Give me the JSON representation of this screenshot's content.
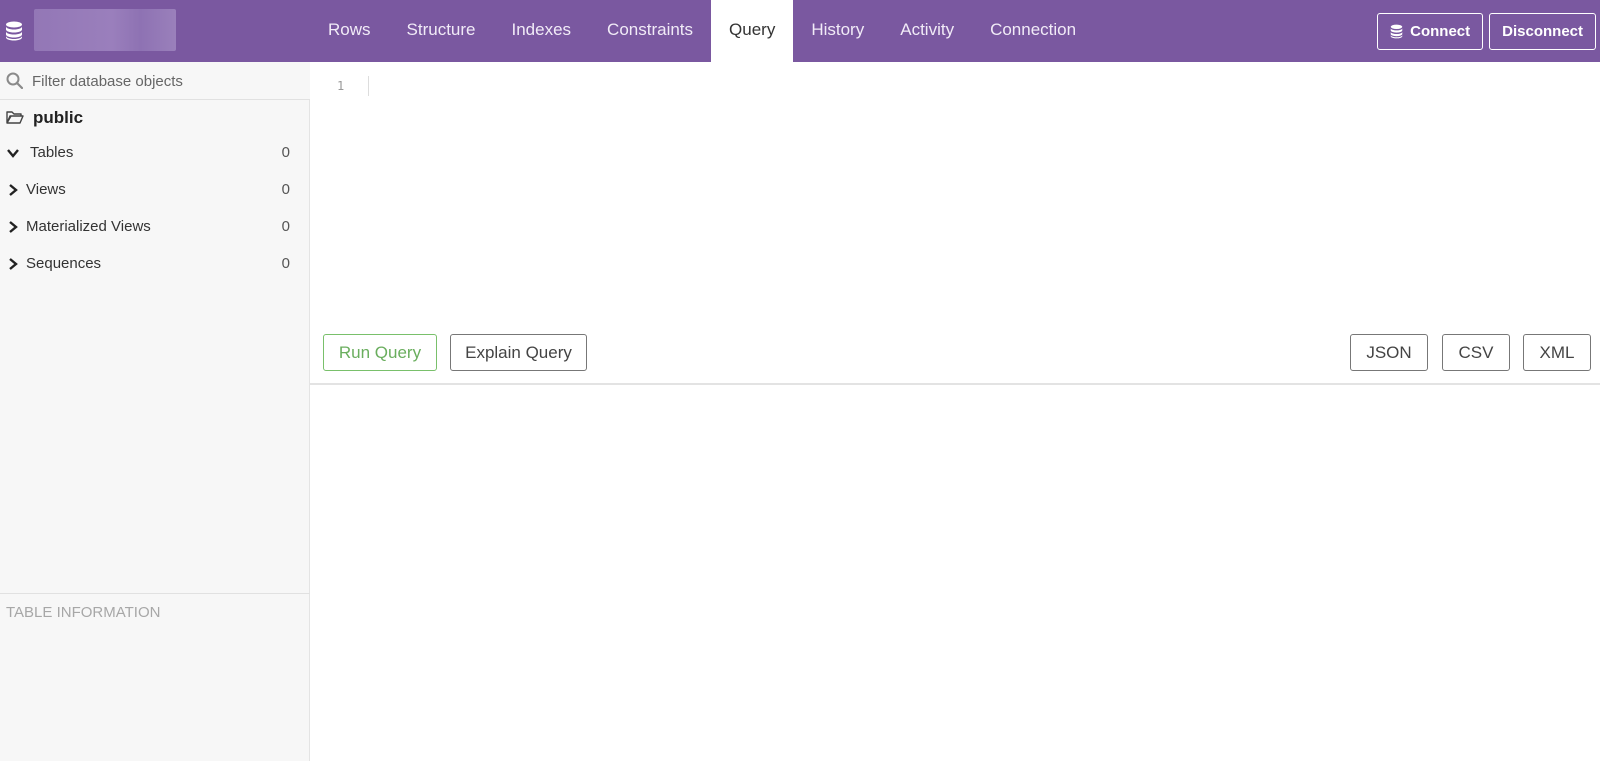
{
  "header": {
    "db_name": "",
    "tabs": [
      {
        "label": "Rows"
      },
      {
        "label": "Structure"
      },
      {
        "label": "Indexes"
      },
      {
        "label": "Constraints"
      },
      {
        "label": "Query",
        "active": true
      },
      {
        "label": "History"
      },
      {
        "label": "Activity"
      },
      {
        "label": "Connection"
      }
    ],
    "connect_label": "Connect",
    "disconnect_label": "Disconnect"
  },
  "sidebar": {
    "filter_placeholder": "Filter database objects",
    "schema": "public",
    "objects": [
      {
        "label": "Tables",
        "count": "0",
        "expanded": true
      },
      {
        "label": "Views",
        "count": "0",
        "expanded": false
      },
      {
        "label": "Materialized Views",
        "count": "0",
        "expanded": false
      },
      {
        "label": "Sequences",
        "count": "0",
        "expanded": false
      }
    ],
    "table_info_title": "TABLE INFORMATION"
  },
  "editor": {
    "line_number": "1",
    "content": ""
  },
  "toolbar": {
    "run_label": "Run Query",
    "explain_label": "Explain Query",
    "json_label": "JSON",
    "csv_label": "CSV",
    "xml_label": "XML"
  },
  "colors": {
    "header_bg": "#7a58a0",
    "run_accent": "#6aae5e"
  }
}
